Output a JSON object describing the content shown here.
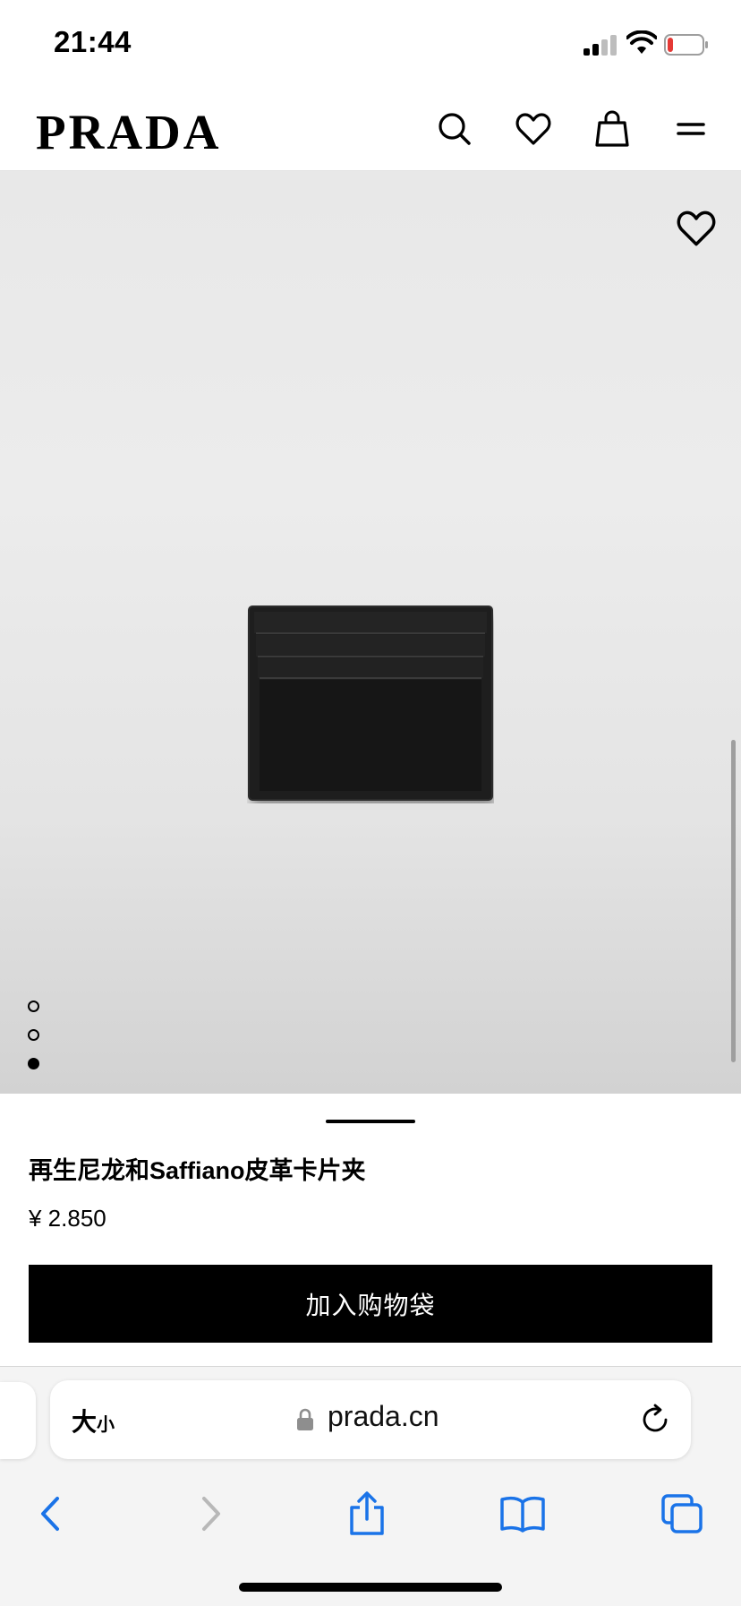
{
  "status_bar": {
    "time": "21:44",
    "battery_color": "#e53935"
  },
  "header": {
    "logo": "PRADA",
    "icons": [
      "search-icon",
      "heart-icon",
      "shopping-bag-icon",
      "menu-icon"
    ]
  },
  "gallery": {
    "dots": [
      {
        "active": false
      },
      {
        "active": false
      },
      {
        "active": true
      }
    ],
    "product_image": "black card holder",
    "background_colors": [
      "#e8e8e8",
      "#d2d2d2"
    ]
  },
  "product": {
    "title": "再生尼龙和Saffiano皮革卡片夹",
    "price": "¥ 2.850",
    "add_to_bag_label": "加入购物袋"
  },
  "browser": {
    "text_size_big": "大",
    "text_size_small": "小",
    "url": "prada.cn",
    "accent_color": "#1a73e8"
  }
}
